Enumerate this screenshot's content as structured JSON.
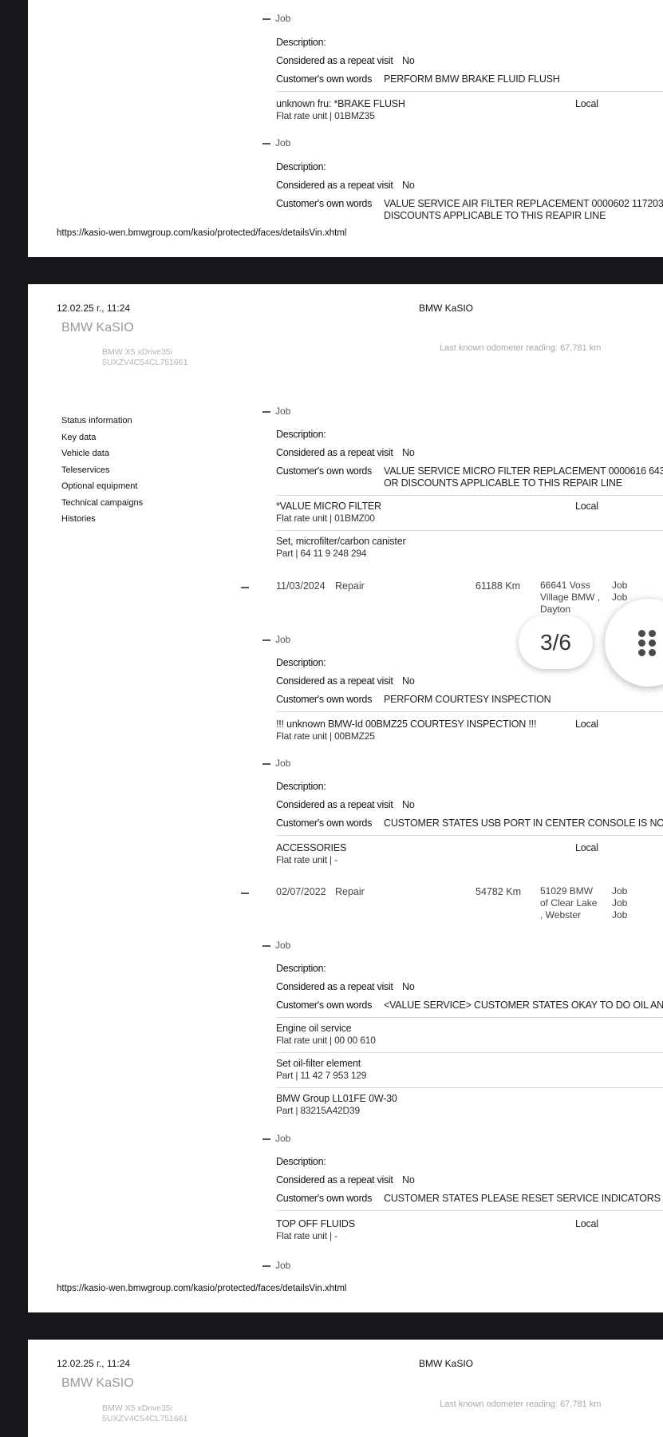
{
  "common": {
    "job_label": "Job",
    "description_label": "Description:",
    "repeat_visit_label": "Considered as a repeat visit",
    "customer_words_label": "Customer's own words",
    "local_label": "Local",
    "url": "https://kasio-wen.bmwgroup.com/kasio/protected/faces/detailsVin.xhtml"
  },
  "header": {
    "datetime": "12.02.25 г., 11:24",
    "center_title": "BMW KaSIO",
    "logo": "BMW KaSIO",
    "vehicle_model": "BMW X5 xDrive35i",
    "vin": "5UXZV4C54CL751661",
    "odometer": "Last known odometer reading: 67,781 km"
  },
  "sidebar": {
    "items": [
      {
        "label": "Status information"
      },
      {
        "label": "Key data"
      },
      {
        "label": "Vehicle data"
      },
      {
        "label": "Teleservices"
      },
      {
        "label": "Optional equipment"
      },
      {
        "label": "Technical campaigns"
      },
      {
        "label": "Histories"
      }
    ]
  },
  "page1": {
    "jobs": [
      {
        "repeat_visit": "No",
        "customer_words": "PERFORM BMW BRAKE FLUID FLUSH",
        "items": [
          {
            "name": "unknown fru: *BRAKE FLUSH",
            "sub": "Flat rate unit | 01BMZ35",
            "status": "Local"
          }
        ]
      },
      {
        "repeat_visit": "No",
        "customer_words_l1": "VALUE SERVICE AIR FILTER REPLACEMENT 0000602 117203",
        "customer_words_l2": "DISCOUNTS APPLICABLE TO THIS REAPIR LINE"
      }
    ]
  },
  "page2": {
    "job1": {
      "repeat_visit": "No",
      "customer_words_l1": "VALUE SERVICE MICRO FILTER REPLACEMENT 0000616 643",
      "customer_words_l2": "OR DISCOUNTS APPLICABLE TO THIS REPAIR LINE",
      "items": [
        {
          "name": "*VALUE MICRO FILTER",
          "sub": "Flat rate unit | 01BMZ00",
          "status": "Local"
        },
        {
          "name": "Set, microfilter/carbon canister",
          "sub": "Part | 64 11 9 248 294"
        }
      ]
    },
    "visit1": {
      "date": "11/03/2024",
      "type": "Repair",
      "km": "61188 Km",
      "dealer": "66641 Voss Village BMW , Dayton",
      "jobs": [
        "Job",
        "Job"
      ]
    },
    "job2": {
      "repeat_visit": "No",
      "customer_words": "PERFORM COURTESY INSPECTION",
      "items": [
        {
          "name": "!!! unknown BMW-Id 00BMZ25 COURTESY INSPECTION !!!",
          "sub": "Flat rate unit | 00BMZ25",
          "status": "Local"
        }
      ]
    },
    "job3": {
      "repeat_visit": "No",
      "customer_words": "CUSTOMER STATES USB PORT IN CENTER CONSOLE IS NOT",
      "items": [
        {
          "name": "ACCESSORIES",
          "sub": "Flat rate unit | -",
          "status": "Local"
        }
      ]
    },
    "visit2": {
      "date": "02/07/2022",
      "type": "Repair",
      "km": "54782 Km",
      "dealer": "51029 BMW of Clear Lake , Webster",
      "jobs": [
        "Job",
        "Job",
        "Job"
      ]
    },
    "job4": {
      "repeat_visit": "No",
      "customer_words": "<VALUE SERVICE> CUSTOMER STATES OKAY TO DO OIL AND",
      "items": [
        {
          "name": "Engine oil service",
          "sub": "Flat rate unit | 00 00 610"
        },
        {
          "name": "Set oil-filter element",
          "sub": "Part | 11 42 7 953 129"
        },
        {
          "name": "BMW Group LL01FE 0W-30",
          "sub": "Part | 83215A42D39"
        }
      ]
    },
    "job5": {
      "repeat_visit": "No",
      "customer_words": "CUSTOMER STATES PLEASE RESET SERVICE INDICATORS",
      "items": [
        {
          "name": "TOP OFF FLUIDS",
          "sub": "Flat rate unit | -",
          "status": "Local"
        }
      ]
    }
  },
  "viewer": {
    "page_counter": "3/6",
    "menu_icon": "grid-dots-icon"
  }
}
